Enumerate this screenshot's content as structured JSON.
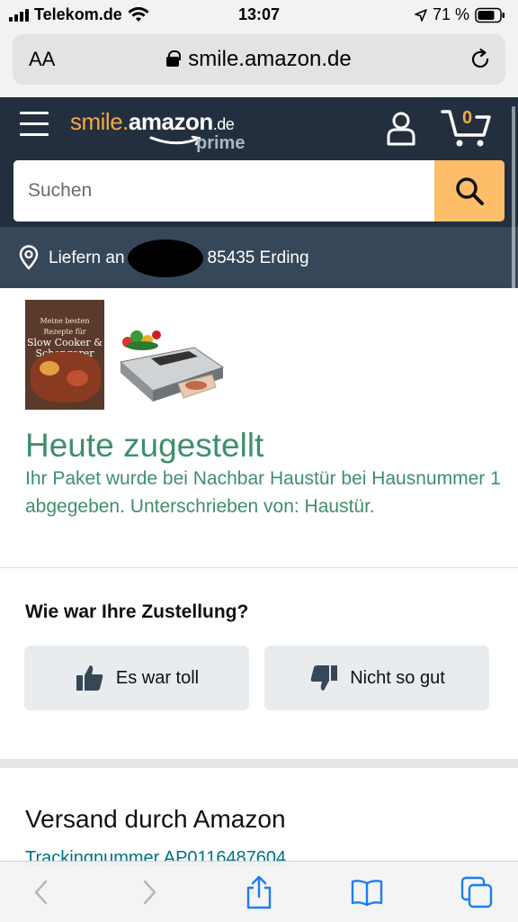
{
  "status_bar": {
    "carrier": "Telekom.de",
    "time": "13:07",
    "battery": "71 %"
  },
  "browser": {
    "text_size_label": "AA",
    "url": "smile.amazon.de"
  },
  "header": {
    "logo_smile": "smile.",
    "logo_amazon": "amazon",
    "logo_de": ".de",
    "logo_prime": "prime",
    "cart_count": "0",
    "search_placeholder": "Suchen"
  },
  "delivery_bar": {
    "prefix": "Liefern an",
    "location": "85435 Erding"
  },
  "shipment": {
    "status_title": "Heute zugestellt",
    "status_message": "Ihr Paket wurde bei Nachbar Haustür bei Hausnummer 1 abgegeben. Unterschrieben von: Haustür.",
    "book_title_small": "Meine besten Rezepte für",
    "book_title": "Slow Cooker & Schongarer"
  },
  "feedback": {
    "question": "Wie war Ihre Zustellung?",
    "good_label": "Es war toll",
    "bad_label": "Nicht so gut"
  },
  "shipping": {
    "title": "Versand durch Amazon",
    "tracking": "Trackingnummer AP0116487604"
  },
  "colors": {
    "header_bg": "#232f3e",
    "delivery_bg": "#37475a",
    "accent_orange": "#f3a847",
    "search_button": "#febd69",
    "delivered_green": "#3f8f6b",
    "link_teal": "#007185"
  },
  "icons": {
    "toolbar": [
      "back-icon",
      "forward-icon",
      "share-icon",
      "bookmarks-icon",
      "tabs-icon"
    ]
  }
}
